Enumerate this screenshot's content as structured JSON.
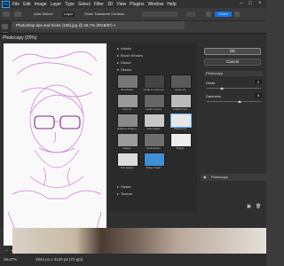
{
  "menubar": {
    "items": [
      "File",
      "Edit",
      "Image",
      "Layer",
      "Type",
      "Select",
      "Filter",
      "3D",
      "View",
      "Plugins",
      "Window",
      "Help"
    ],
    "app_logo": "Ps"
  },
  "options": {
    "auto_select_label": "Auto-Select:",
    "auto_select_value": "Layer",
    "transform_label": "Show Transform Controls",
    "share_label": "Share"
  },
  "document": {
    "tab_title": "Photoshop tips and tricks (189).jpg @ 26.7% (RGB/8*) ×"
  },
  "dialog": {
    "title": "Photocopy (25%)",
    "zoom_value": "25%",
    "ok_label": "OK",
    "cancel_label": "Cancel",
    "filter_name": "Photocopy",
    "params": [
      {
        "label": "Detail",
        "value": "2"
      },
      {
        "label": "Darkness",
        "value": "8"
      }
    ],
    "layer_name": "Photocopy"
  },
  "gallery": {
    "categories_top": [
      "Artistic",
      "Brush Strokes",
      "Distort"
    ],
    "open_category": "Sketch",
    "thumbs": [
      "Bas Relief",
      "Chalk & Charcoal",
      "Charcoal",
      "Chrome",
      "Conté Crayon",
      "Graphic Pen",
      "Halftone Pattern",
      "Note Paper",
      "Photocopy",
      "Plaster",
      "Reticulation",
      "Stamp",
      "Torn Edges",
      "Water Paper"
    ],
    "categories_bottom": [
      "Stylize",
      "Texture"
    ]
  },
  "status": {
    "zoom": "26.67%",
    "doc_info": "2844 px x 4128 px (72 ppi)"
  }
}
